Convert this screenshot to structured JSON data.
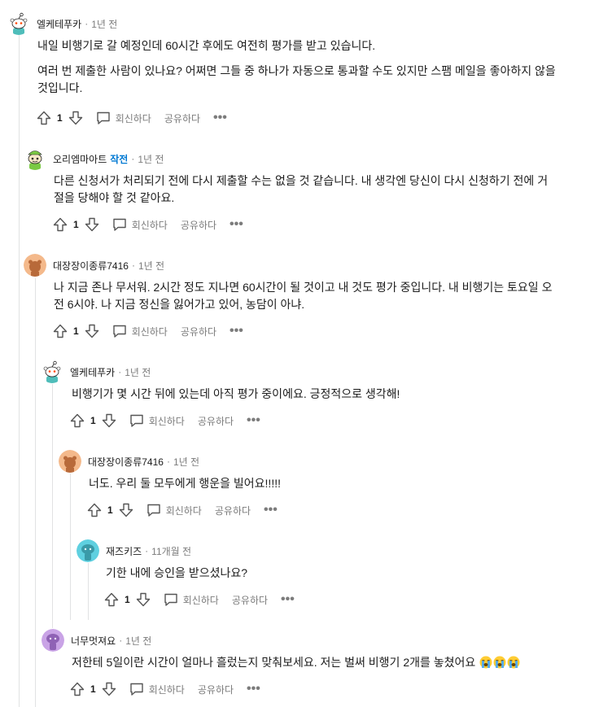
{
  "actions": {
    "reply_label": "회신하다",
    "share_label": "공유하다",
    "more_label": "•••"
  },
  "comments": [
    {
      "author": "엘케테푸카",
      "time": "1년 전",
      "paragraphs": [
        "내일 비행기로 갈 예정인데 60시간 후에도 여전히 평가를 받고 있습니다.",
        "여러 번 제출한 사람이 있나요? 어쩌면 그들 중 하나가 자동으로 통과할 수도 있지만 스팸 메일을 좋아하지 않을 것입니다."
      ],
      "score": "1"
    },
    {
      "author": "오리엠마아트",
      "op_badge": "작전",
      "time": "1년 전",
      "paragraphs": [
        "다른 신청서가 처리되기 전에 다시 제출할 수는 없을 것 같습니다. 내 생각엔 당신이 다시 신청하기 전에 거절을 당해야 할 것 같아요."
      ],
      "score": "1"
    },
    {
      "author": "대장장이종류7416",
      "time": "1년 전",
      "paragraphs": [
        "나 지금 존나 무서워. 2시간 정도 지나면 60시간이 될 것이고 내 것도 평가 중입니다. 내 비행기는 토요일 오전 6시야. 나 지금 정신을 잃어가고 있어, 농담이 아냐."
      ],
      "score": "1"
    },
    {
      "author": "엘케테푸카",
      "time": "1년 전",
      "paragraphs": [
        "비행기가 몇 시간 뒤에 있는데 아직 평가 중이에요. 긍정적으로 생각해!"
      ],
      "score": "1"
    },
    {
      "author": "대장장이종류7416",
      "time": "1년 전",
      "paragraphs": [
        "너도. 우리 둘 모두에게 행운을 빌어요!!!!!"
      ],
      "score": "1"
    },
    {
      "author": "재즈키즈",
      "time": "11개월 전",
      "paragraphs": [
        "기한 내에 승인을 받으셨나요?"
      ],
      "score": "1"
    },
    {
      "author": "너무멋져요",
      "time": "1년 전",
      "paragraphs": [
        "저한테 5일이란 시간이 얼마나 흘렀는지 맞춰보세요. 저는 벌써 비행기 2개를 놓쳤어요"
      ],
      "score": "1"
    }
  ],
  "colors": {
    "snoo_teal": "#4fbdba",
    "snoo_orange": "#ff4500",
    "bear_orange": "#f4b98b",
    "bear_brown": "#b86a3a",
    "duck_green": "#7ac943",
    "ghost_purple": "#c9a3e6",
    "ghost_teal": "#5fd0e0",
    "op_blue": "#0079d3"
  },
  "icons": [
    "upvote-icon",
    "downvote-icon",
    "comment-bubble-icon",
    "loudly-crying-face-emoji"
  ]
}
